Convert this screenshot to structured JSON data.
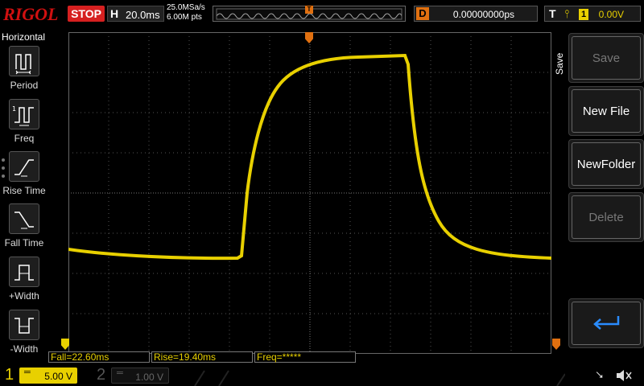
{
  "brand": {
    "logo": "RIGOL"
  },
  "header": {
    "run_state": "STOP",
    "timebase_label": "H",
    "timebase_value": "20.0ms",
    "sample_rate": "25.0MSa/s",
    "memory_depth": "6.00M pts",
    "trigger_pos_marker": "T",
    "delay_label": "D",
    "delay_value": "0.00000000ps",
    "trigger_label": "T",
    "trigger_edge_icon": "rising-edge-icon",
    "trigger_channel": "1",
    "trigger_level": "0.00V"
  },
  "left_menu": {
    "title": "Horizontal",
    "items": [
      {
        "label": "Period",
        "icon": "period-icon"
      },
      {
        "label": "Freq",
        "icon": "frequency-icon"
      },
      {
        "label": "Rise Time",
        "icon": "rise-time-icon"
      },
      {
        "label": "Fall Time",
        "icon": "fall-time-icon"
      },
      {
        "label": "+Width",
        "icon": "positive-width-icon"
      },
      {
        "label": "-Width",
        "icon": "negative-width-icon"
      }
    ]
  },
  "right_menu": {
    "title": "Save",
    "softkeys": [
      {
        "label": "Save",
        "enabled": false
      },
      {
        "label": "New File",
        "enabled": true
      },
      {
        "label": "NewFolder",
        "enabled": true
      },
      {
        "label": "Delete",
        "enabled": false
      },
      {
        "label": "",
        "icon": "return-arrow-icon",
        "enabled": true
      }
    ]
  },
  "measurements": {
    "fall": "Fall=22.60ms",
    "rise": "Rise=19.40ms",
    "freq": "Freq=*****"
  },
  "channels": [
    {
      "num": "1",
      "scale": "5.00 V",
      "coupling_icon": "dc-coupling-icon",
      "color": "#e8d000",
      "active": true
    },
    {
      "num": "2",
      "scale": "1.00 V",
      "coupling_icon": "dc-coupling-icon",
      "color": "#00a8a8",
      "active": false
    }
  ],
  "status_icons": [
    "usb-icon",
    "speaker-muted-icon"
  ],
  "colors": {
    "ch1": "#e8d000",
    "ch2": "#00a8a8",
    "stop": "#d62020",
    "trigger_marker": "#e07010"
  }
}
